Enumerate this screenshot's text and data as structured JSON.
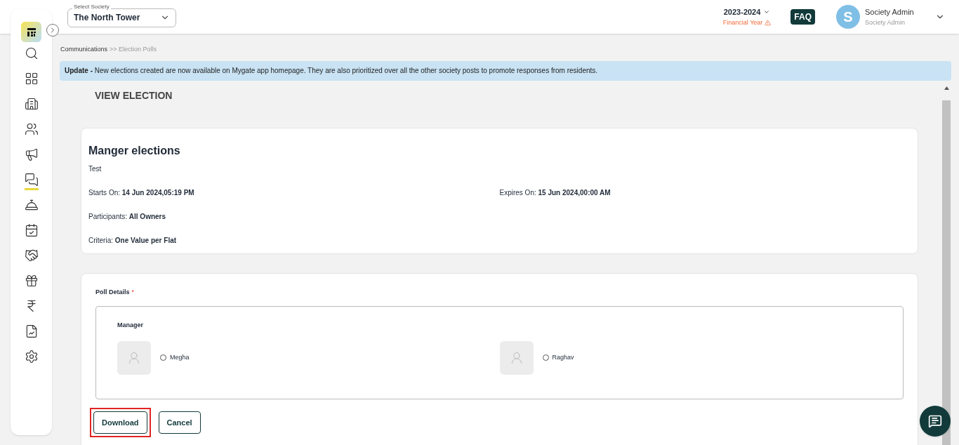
{
  "header": {
    "society_select": {
      "label": "Select Society",
      "value": "The North Tower"
    },
    "financial_year": {
      "value": "2023-2024",
      "label": "Financial Year"
    },
    "faq": "FAQ",
    "user": {
      "initial": "S",
      "name": "Society Admin",
      "role": "Society Admin"
    }
  },
  "sidebar": {
    "items": [
      {
        "kind": "search",
        "selected": false
      },
      {
        "kind": "dashboard",
        "selected": false
      },
      {
        "kind": "building",
        "selected": false
      },
      {
        "kind": "people",
        "selected": false
      },
      {
        "kind": "megaphone",
        "selected": false
      },
      {
        "kind": "chat",
        "selected": true
      },
      {
        "kind": "desk",
        "selected": false
      },
      {
        "kind": "calendar",
        "selected": false
      },
      {
        "kind": "handshake",
        "selected": false
      },
      {
        "kind": "gift",
        "selected": false
      },
      {
        "kind": "rupee",
        "selected": false
      },
      {
        "kind": "report",
        "selected": false
      },
      {
        "kind": "settings",
        "selected": false
      }
    ]
  },
  "breadcrumb": [
    {
      "label": "Communications"
    },
    {
      "label": ">> Election Polls"
    }
  ],
  "banner": "**Update -** New elections created are now available on Mygate app homepage. They are also prioritized over all the other society posts to promote responses from residents.",
  "page_title": "VIEW ELECTION",
  "election": {
    "title": "Manger elections",
    "description": "Test",
    "fields": [
      {
        "text": "Starts On: **14 Jun 2024,05:19 PM**"
      },
      {
        "text": "Expires On: **15 Jun 2024,00:00 AM**"
      },
      {
        "text": "Participants: **All Owners**"
      },
      {
        "text": "Criteria: **One Value per Flat**"
      }
    ]
  },
  "poll": {
    "label": "Poll Details",
    "required_mark": "*",
    "position": "Manager",
    "candidates": [
      {
        "name": "Megha",
        "selected": false
      },
      {
        "name": "Raghav",
        "selected": false
      }
    ]
  },
  "buttons": [
    {
      "label": "Download",
      "highlighted": true
    },
    {
      "label": "Cancel",
      "highlighted": false
    }
  ]
}
